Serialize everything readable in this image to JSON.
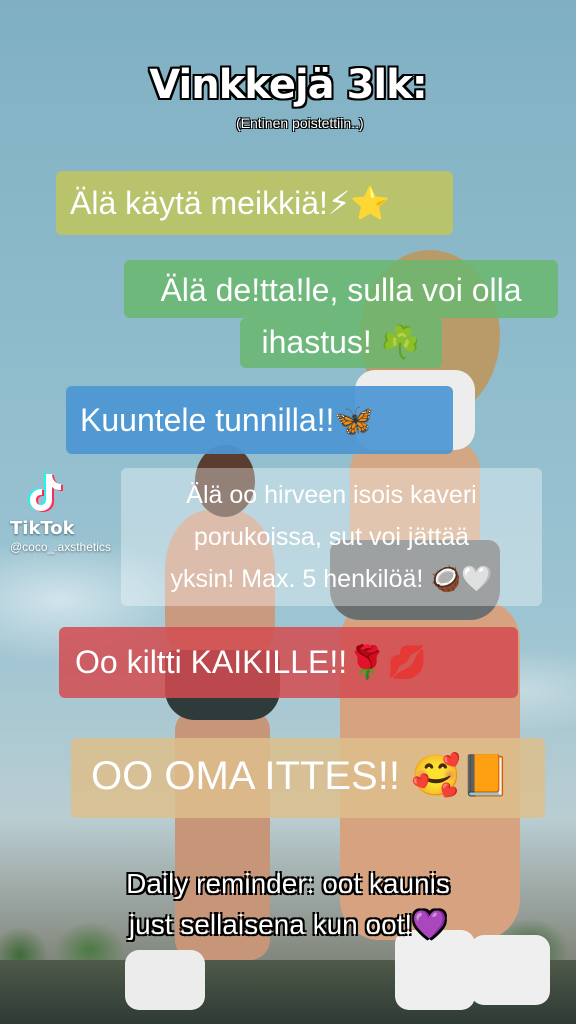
{
  "title": "Vinkkejä 3lk:",
  "subtitle": "(Entinen poistettiin..)",
  "tips": [
    {
      "text": "Älä käytä meikkiä!⚡⭐"
    },
    {
      "line1": "Älä de!tta!le, sulla voi olla",
      "line2": "ihastus! ☘️"
    },
    {
      "text": "Kuuntele tunnilla!!🦋"
    },
    {
      "line1": "Älä oo hirveen isois kaveri",
      "line2": "porukoissa, sut voi jättää",
      "line3": "yksin! Max. 5 henkilöä! 🥥🤍"
    },
    {
      "text": "Oo kiltti KAIKILLE!!🌹💋"
    },
    {
      "text": "OO OMA ITTES!! 🥰📙"
    }
  ],
  "reminder": {
    "line1": "Daily reminder: oot kaunis",
    "line2": "just sellaisena kun oot!💜"
  },
  "watermark": {
    "app": "TikTok",
    "user": "@coco_.axsthetics"
  }
}
